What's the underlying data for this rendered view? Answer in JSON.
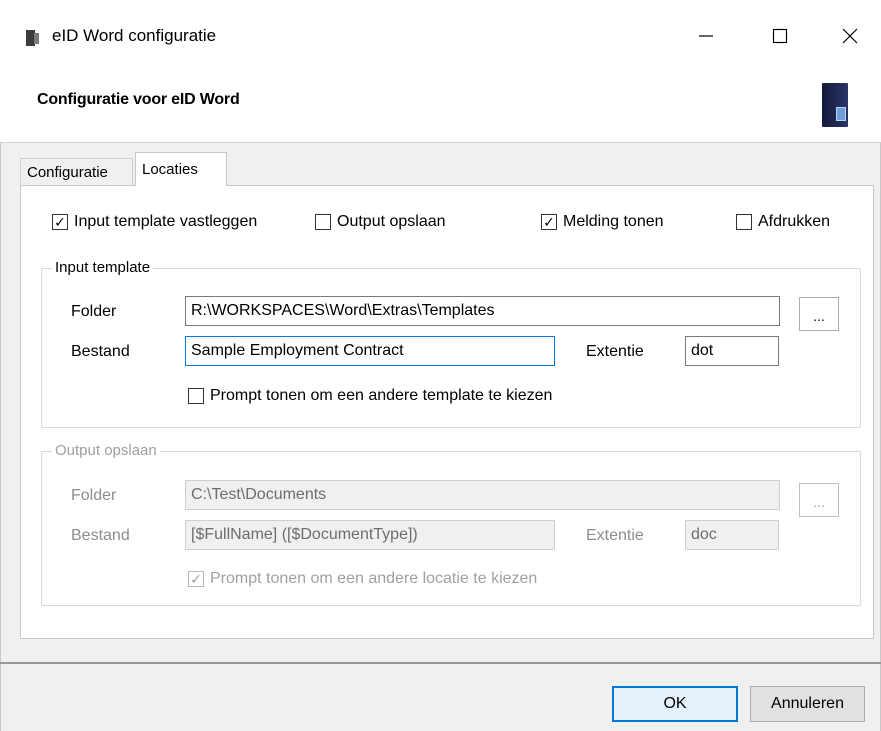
{
  "window": {
    "title": "eID Word configuratie",
    "controls": {
      "minimize": "—",
      "maximize": "☐",
      "close": "✕"
    }
  },
  "header": {
    "title": "Configuratie voor eID Word",
    "logo_icon": "eid-card-reader-icon"
  },
  "tabs": [
    {
      "label": "Configuratie",
      "active": false
    },
    {
      "label": "Locaties",
      "active": true
    }
  ],
  "options": {
    "input_template_vastleggen": {
      "label": "Input template vastleggen",
      "checked": true
    },
    "output_opslaan": {
      "label": "Output opslaan",
      "checked": false
    },
    "melding_tonen": {
      "label": "Melding tonen",
      "checked": true
    },
    "afdrukken": {
      "label": "Afdrukken",
      "checked": false
    }
  },
  "input_template": {
    "legend": "Input template",
    "folder_label": "Folder",
    "folder_value": "R:\\WORKSPACES\\Word\\Extras\\Templates",
    "browse_label": "...",
    "bestand_label": "Bestand",
    "bestand_value": "Sample Employment Contract",
    "extentie_label": "Extentie",
    "extentie_value": "dot",
    "prompt": {
      "label": "Prompt tonen om een andere template te kiezen",
      "checked": false
    }
  },
  "output_opslaan": {
    "legend": "Output opslaan",
    "enabled": false,
    "folder_label": "Folder",
    "folder_value": "C:\\Test\\Documents",
    "browse_label": "...",
    "bestand_label": "Bestand",
    "bestand_value": "[$FullName] ([$DocumentType])",
    "extentie_label": "Extentie",
    "extentie_value": "doc",
    "prompt": {
      "label": "Prompt tonen om een andere locatie te kiezen",
      "checked": true
    }
  },
  "footer": {
    "ok_label": "OK",
    "cancel_label": "Annuleren"
  },
  "colors": {
    "accent": "#0078d7",
    "panel_bg": "#f0f0f0",
    "disabled_text": "#a0a0a0"
  }
}
